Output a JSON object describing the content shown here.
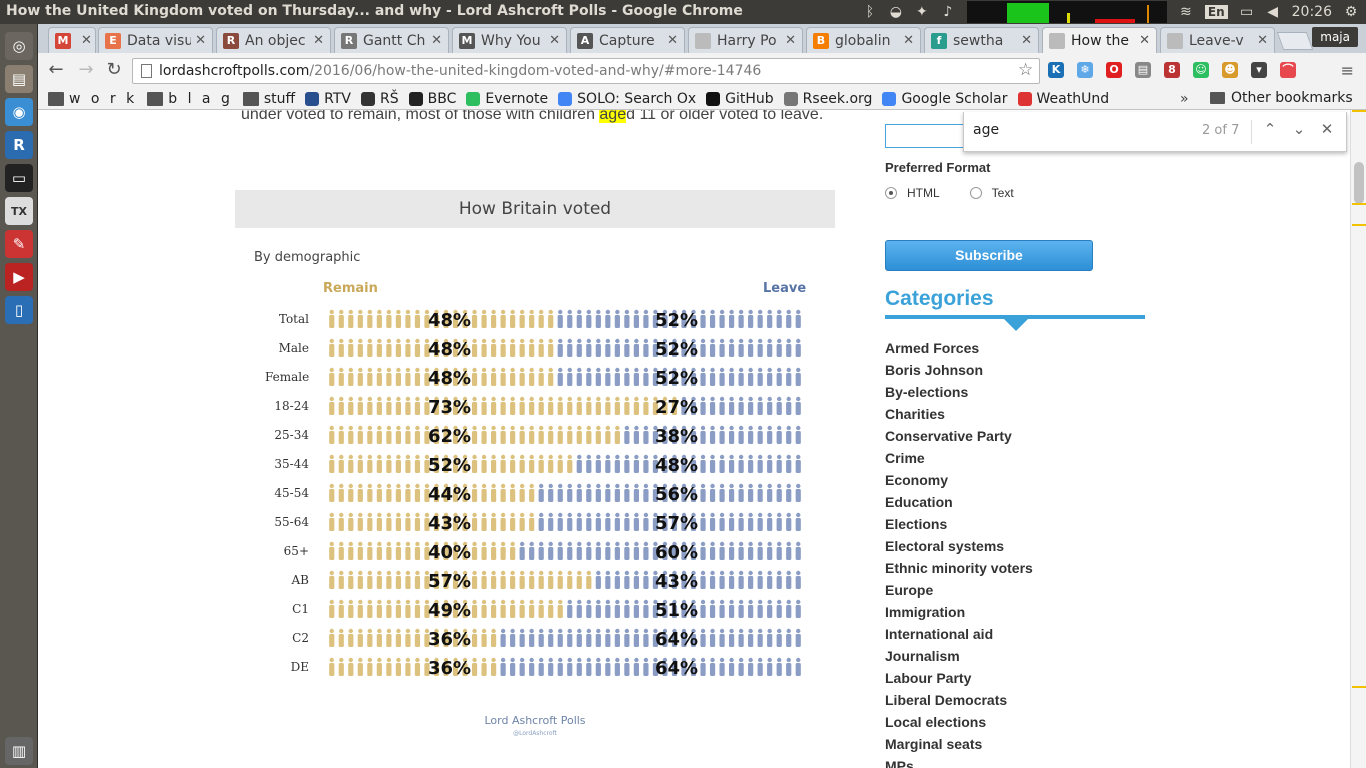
{
  "window_title": "How the United Kingdom voted on Thursday... and why - Lord Ashcroft Polls - Google Chrome",
  "panel": {
    "keyboard_layout": "En",
    "clock": "20:26",
    "user": "maja"
  },
  "tabs": [
    {
      "title": "",
      "icon": "gmail-icon",
      "color": "#d44638",
      "glyph": "M"
    },
    {
      "title": "Data visu",
      "icon": "e-icon",
      "color": "#e8734a",
      "glyph": "E"
    },
    {
      "title": "An objec",
      "icon": "r-icon",
      "color": "#8a4b3c",
      "glyph": "R"
    },
    {
      "title": "Gantt Ch",
      "icon": "r-icon",
      "color": "#777",
      "glyph": "R"
    },
    {
      "title": "Why You",
      "icon": "m-icon",
      "color": "#555",
      "glyph": "M"
    },
    {
      "title": "Capture",
      "icon": "a-icon",
      "color": "#555",
      "glyph": "A"
    },
    {
      "title": "Harry Po",
      "icon": "page-icon",
      "color": "#bbb",
      "glyph": ""
    },
    {
      "title": "globalin",
      "icon": "blogger-icon",
      "color": "#f57d00",
      "glyph": "B"
    },
    {
      "title": "sewtha",
      "icon": "f-icon",
      "color": "#2a9d8f",
      "glyph": "f"
    },
    {
      "title": "How the",
      "icon": "page-icon",
      "color": "#bbb",
      "glyph": "",
      "active": true
    },
    {
      "title": "Leave-v",
      "icon": "page-icon",
      "color": "#bbb",
      "glyph": ""
    }
  ],
  "address": {
    "domain": "lordashcroftpolls.com",
    "path": "/2016/06/how-the-united-kingdom-voted-and-why/#more-14746"
  },
  "extensions": [
    {
      "name": "k-extension-icon",
      "color": "#1a6fb5",
      "glyph": "K"
    },
    {
      "name": "snowflake-extension-icon",
      "color": "#5fa8e8",
      "glyph": "❄"
    },
    {
      "name": "opera-extension-icon",
      "color": "#e02020",
      "glyph": "O"
    },
    {
      "name": "book-extension-icon",
      "color": "#888",
      "glyph": "▤"
    },
    {
      "name": "bird-extension-icon",
      "color": "#b33",
      "glyph": "8"
    },
    {
      "name": "evernote-extension-icon",
      "color": "#2dbe60",
      "glyph": "☺"
    },
    {
      "name": "face-extension-icon",
      "color": "#d89a2b",
      "glyph": "☻"
    },
    {
      "name": "pocket-extension-icon",
      "color": "#444",
      "glyph": "▾"
    },
    {
      "name": "rainbow-extension-icon",
      "color": "#e6484d",
      "glyph": "⌒"
    }
  ],
  "bookmarks": [
    {
      "label": "w o r k",
      "icon": "folder-icon"
    },
    {
      "label": "b l a g",
      "icon": "folder-icon"
    },
    {
      "label": "stuff",
      "icon": "folder-icon"
    },
    {
      "label": "RTV",
      "icon": "rtv-icon"
    },
    {
      "label": "RŠ",
      "icon": "rs-icon"
    },
    {
      "label": "BBC",
      "icon": "bbc-icon"
    },
    {
      "label": "Evernote",
      "icon": "evernote-icon"
    },
    {
      "label": "SOLO: Search Ox",
      "icon": "google-icon"
    },
    {
      "label": "GitHub",
      "icon": "github-icon"
    },
    {
      "label": "Rseek.org",
      "icon": "rseek-icon"
    },
    {
      "label": "Google Scholar",
      "icon": "google-icon"
    },
    {
      "label": "WeathUnd",
      "icon": "wunderground-icon"
    }
  ],
  "bookmarks_more": "»",
  "other_bookmarks": "Other bookmarks",
  "article": {
    "text_before": "under voted to remain, most of those with children ",
    "highlight": "age",
    "text_after": "d 11 or older voted to leave."
  },
  "infographic": {
    "title": "How Britain voted",
    "subtitle": "By demographic",
    "remain_label": "Remain",
    "leave_label": "Leave",
    "footer": "Lord Ashcroft Polls",
    "twitter": "@LordAshcroft"
  },
  "chart_data": {
    "type": "bar",
    "title": "How Britain voted",
    "subtitle": "By demographic",
    "categories": [
      "Total",
      "Male",
      "Female",
      "18-24",
      "25-34",
      "35-44",
      "45-54",
      "55-64",
      "65+",
      "AB",
      "C1",
      "C2",
      "DE"
    ],
    "series": [
      {
        "name": "Remain",
        "color": "#dcc27e",
        "values": [
          48,
          48,
          48,
          73,
          62,
          52,
          44,
          43,
          40,
          57,
          49,
          36,
          36
        ]
      },
      {
        "name": "Leave",
        "color": "#8b9dc4",
        "values": [
          52,
          52,
          52,
          27,
          38,
          48,
          56,
          57,
          60,
          43,
          51,
          64,
          64
        ]
      }
    ],
    "unit": "%"
  },
  "sidebar": {
    "preferred_format": "Preferred Format",
    "format_options": [
      "HTML",
      "Text"
    ],
    "selected_format": "HTML",
    "subscribe": "Subscribe",
    "categories_title": "Categories",
    "categories": [
      "Armed Forces",
      "Boris Johnson",
      "By-elections",
      "Charities",
      "Conservative Party",
      "Crime",
      "Economy",
      "Education",
      "Elections",
      "Electoral systems",
      "Ethnic minority voters",
      "Europe",
      "Immigration",
      "International aid",
      "Journalism",
      "Labour Party",
      "Liberal Democrats",
      "Local elections",
      "Marginal seats",
      "MPs"
    ]
  },
  "find": {
    "query": "age",
    "count": "2 of 7"
  }
}
